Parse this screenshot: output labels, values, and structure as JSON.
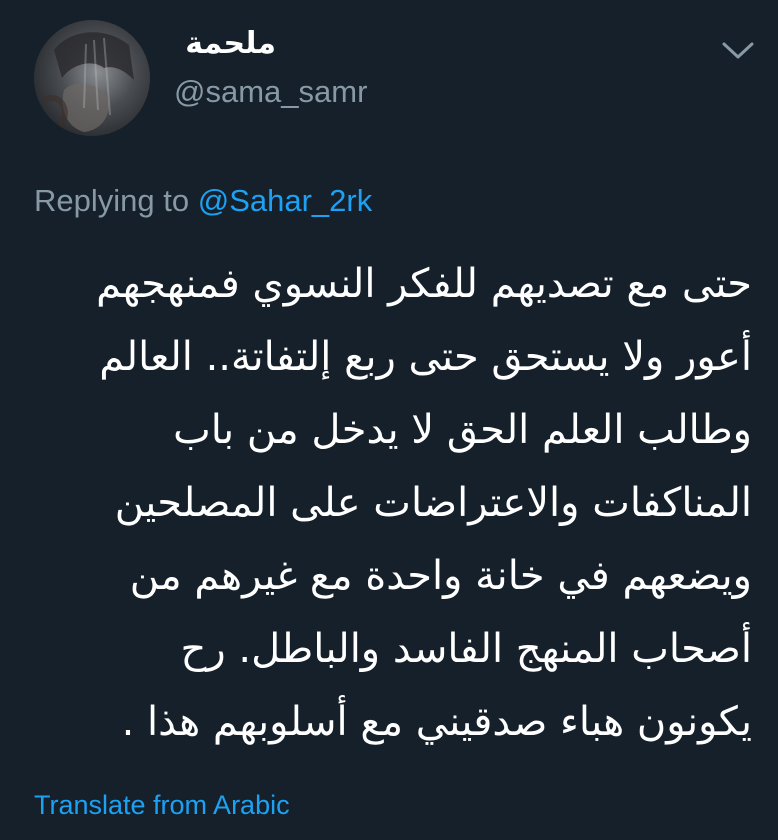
{
  "user": {
    "display_name": "ملحمة",
    "handle": "@sama_samr"
  },
  "reply": {
    "prefix": "Replying to ",
    "target": "@Sahar_2rk"
  },
  "tweet": {
    "lines": [
      "حتى مع تصديهم للفكر النسوي فمنهجهم",
      "أعور ولا يستحق حتى ربع إلتفاتة.. العالم",
      "وطالب العلم الحق لا يدخل من باب",
      "المناكفات والاعتراضات على المصلحين",
      "ويضعهم في خانة واحدة مع غيرهم من",
      "أصحاب المنهج الفاسد والباطل. رح",
      "يكونون هباء صدقيني مع أسلوبهم هذا ."
    ]
  },
  "translate_label": "Translate from Arabic",
  "icons": {
    "menu": "chevron-down-icon",
    "avatar": "profile-photo"
  },
  "colors": {
    "background": "#15202b",
    "text": "#ffffff",
    "secondary_text": "#8899a6",
    "link": "#1da1f2"
  }
}
